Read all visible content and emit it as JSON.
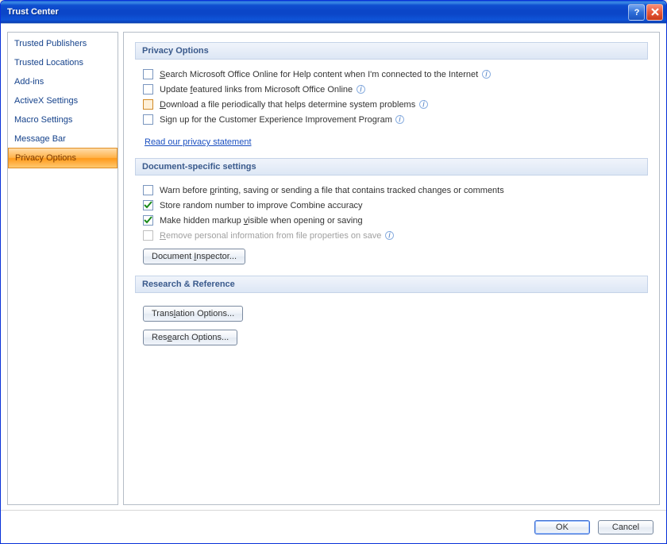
{
  "window": {
    "title": "Trust Center"
  },
  "sidebar": {
    "items": [
      {
        "label": "Trusted Publishers"
      },
      {
        "label": "Trusted Locations"
      },
      {
        "label": "Add-ins"
      },
      {
        "label": "ActiveX Settings"
      },
      {
        "label": "Macro Settings"
      },
      {
        "label": "Message Bar"
      },
      {
        "label": "Privacy Options"
      }
    ],
    "selected_index": 6
  },
  "sections": {
    "privacy": {
      "title": "Privacy Options",
      "items": [
        {
          "text": "Search Microsoft Office Online for Help content when I'm connected to the Internet",
          "underline": "S",
          "checked": false,
          "info": true
        },
        {
          "text": "Update featured links from Microsoft Office Online",
          "underline": "f",
          "checked": false,
          "info": true
        },
        {
          "text": "Download a file periodically that helps determine system problems",
          "underline": "D",
          "checked": false,
          "info": true,
          "highlight": true
        },
        {
          "text": "Sign up for the Customer Experience Improvement Program",
          "underline": "",
          "checked": false,
          "info": true
        }
      ],
      "link": "Read our privacy statement"
    },
    "doc": {
      "title": "Document-specific settings",
      "items": [
        {
          "text": "Warn before printing, saving or sending a file that contains tracked changes or comments",
          "underline": "p",
          "checked": false
        },
        {
          "text": "Store random number to improve Combine accuracy",
          "underline": "",
          "checked": true
        },
        {
          "text": "Make hidden markup visible when opening or saving",
          "underline": "v",
          "checked": true
        },
        {
          "text": "Remove personal information from file properties on save",
          "underline": "R",
          "checked": false,
          "disabled": true,
          "info": true
        }
      ],
      "button": "Document Inspector..."
    },
    "research": {
      "title": "Research & Reference",
      "buttons": {
        "translation": "Translation Options...",
        "research": "Research Options..."
      }
    }
  },
  "footer": {
    "ok": "OK",
    "cancel": "Cancel"
  }
}
